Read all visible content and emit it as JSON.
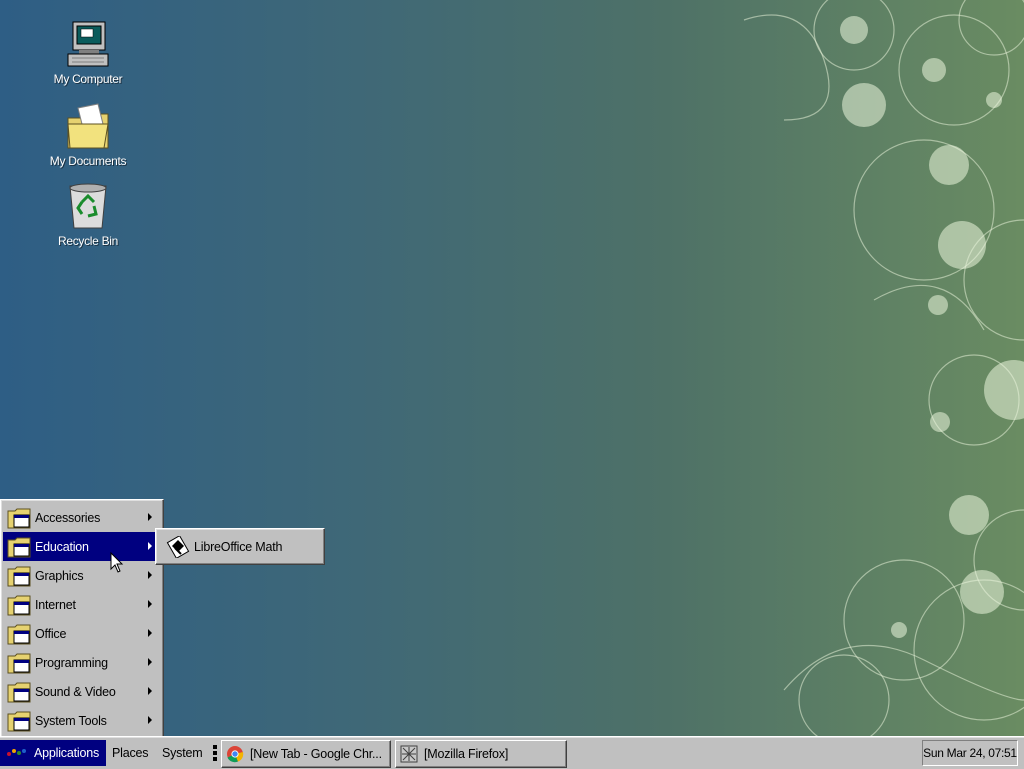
{
  "desktop": {
    "icons": [
      {
        "label": "My Computer",
        "icon": "computer-icon"
      },
      {
        "label": "My Documents",
        "icon": "folder-icon"
      },
      {
        "label": "Recycle Bin",
        "icon": "recycle-bin-icon"
      }
    ]
  },
  "applications_menu": {
    "items": [
      {
        "label": "Accessories",
        "icon": "folder-apps-icon",
        "has_submenu": true
      },
      {
        "label": "Education",
        "icon": "folder-apps-icon",
        "has_submenu": true,
        "active": true
      },
      {
        "label": "Graphics",
        "icon": "folder-apps-icon",
        "has_submenu": true
      },
      {
        "label": "Internet",
        "icon": "folder-apps-icon",
        "has_submenu": true
      },
      {
        "label": "Office",
        "icon": "folder-apps-icon",
        "has_submenu": true
      },
      {
        "label": "Programming",
        "icon": "folder-apps-icon",
        "has_submenu": true
      },
      {
        "label": "Sound & Video",
        "icon": "folder-apps-icon",
        "has_submenu": true
      },
      {
        "label": "System Tools",
        "icon": "folder-apps-icon",
        "has_submenu": true
      }
    ]
  },
  "education_submenu": {
    "items": [
      {
        "label": "LibreOffice Math",
        "icon": "libreoffice-math-icon"
      }
    ]
  },
  "taskbar": {
    "applications_label": "Applications",
    "places_label": "Places",
    "system_label": "System",
    "tasks": [
      {
        "label": "[New Tab - Google Chr...",
        "icon": "chrome-icon"
      },
      {
        "label": "[Mozilla Firefox]",
        "icon": "firefox-icon"
      }
    ],
    "clock": "Sun Mar 24, 07:51"
  },
  "colors": {
    "menu_highlight": "#000080",
    "panel_gray": "#c0c0c0",
    "desktop_left": "#2e5e85",
    "desktop_right": "#6a8c62"
  }
}
